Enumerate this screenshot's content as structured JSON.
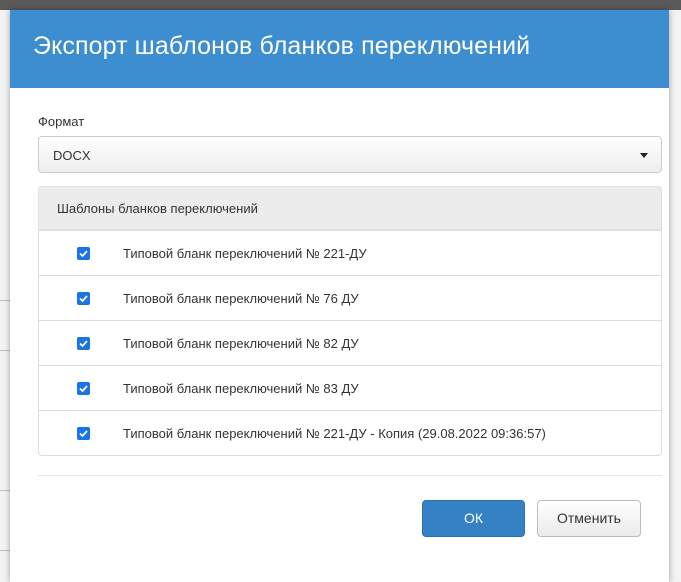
{
  "dialog": {
    "title": "Экспорт шаблонов бланков переключений",
    "format_label": "Формат",
    "format_value": "DOCX",
    "templates_heading": "Шаблоны бланков переключений",
    "templates": [
      {
        "label": "Типовой бланк переключений № 221-ДУ",
        "checked": true
      },
      {
        "label": "Типовой бланк переключений № 76 ДУ",
        "checked": true
      },
      {
        "label": "Типовой бланк переключений № 82 ДУ",
        "checked": true
      },
      {
        "label": "Типовой бланк переключений № 83 ДУ",
        "checked": true
      },
      {
        "label": "Типовой бланк переключений № 221-ДУ - Копия (29.08.2022 09:36:57)",
        "checked": true
      }
    ],
    "ok_label": "ОК",
    "cancel_label": "Отменить"
  },
  "colors": {
    "header": "#3d8ed0",
    "primary_button": "#3581c6",
    "checkbox": "#1a73e8"
  }
}
